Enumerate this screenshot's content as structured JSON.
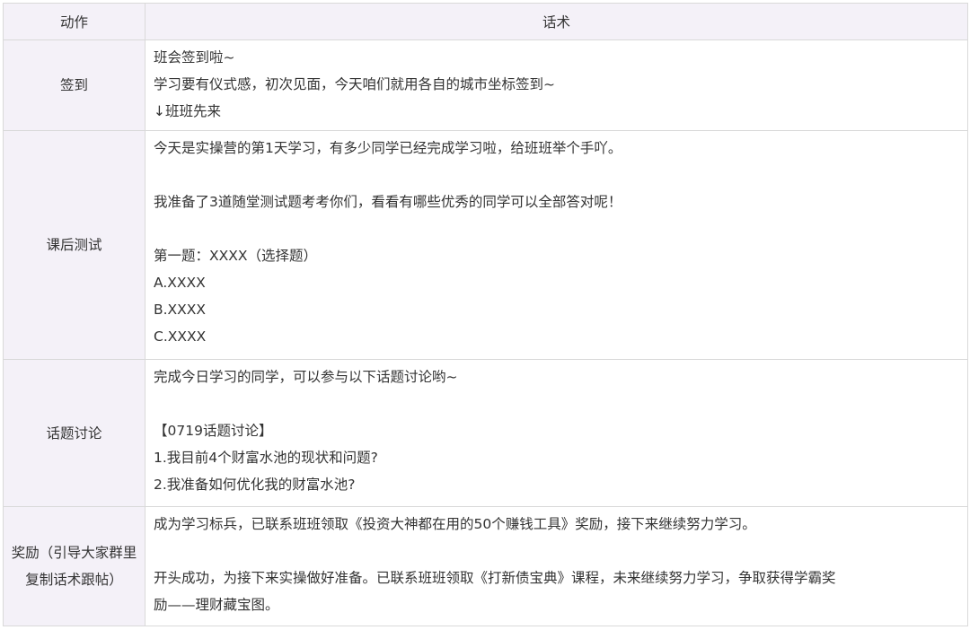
{
  "header": {
    "action_label": "动作",
    "script_label": "话术"
  },
  "rows": [
    {
      "action": "签到",
      "script": [
        "班会签到啦~",
        "学习要有仪式感，初次见面，今天咱们就用各自的城市坐标签到~",
        "↓班班先来"
      ]
    },
    {
      "action": "课后测试",
      "script": [
        "今天是实操营的第1天学习，有多少同学已经完成学习啦，给班班举个手吖。",
        "",
        "我准备了3道随堂测试题考考你们，看看有哪些优秀的同学可以全部答对呢！",
        "",
        "第一题：XXXX（选择题）",
        "A.XXXX",
        "B.XXXX",
        "C.XXXX"
      ]
    },
    {
      "action": "话题讨论",
      "script": [
        "完成今日学习的同学，可以参与以下话题讨论哟~",
        "",
        "【0719话题讨论】",
        "1.我目前4个财富水池的现状和问题?",
        "2.我准备如何优化我的财富水池?"
      ]
    },
    {
      "action": "奖励（引导大家群里复制话术跟帖）",
      "script": [
        "成为学习标兵，已联系班班领取《投资大神都在用的50个赚钱工具》奖励，接下来继续努力学习。",
        "",
        "开头成功，为接下来实操做好准备。已联系班班领取《打新债宝典》课程，未来继续努力学习，争取获得学霸奖",
        "励——理财藏宝图。"
      ]
    }
  ]
}
